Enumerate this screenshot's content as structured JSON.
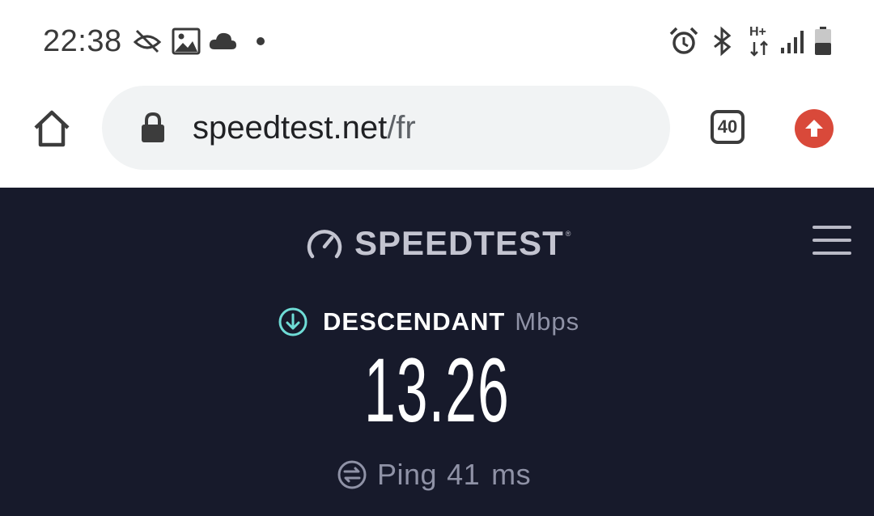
{
  "status_bar": {
    "time": "22:38",
    "icons_left": [
      "eye-off-icon",
      "image-icon",
      "cloud-icon",
      "dot-icon"
    ],
    "icons_right": [
      "alarm-icon",
      "bluetooth-icon",
      "hplus-data-icon",
      "signal-icon",
      "battery-icon"
    ],
    "network_label": "H+"
  },
  "browser": {
    "url_domain": "speedtest.net",
    "url_path": "/fr",
    "tab_count": "40"
  },
  "page": {
    "brand": "SPEEDTEST",
    "trademark": "®",
    "download_label": "DESCENDANT",
    "unit": "Mbps",
    "speed_value": "13.26",
    "ping_label": "Ping",
    "ping_value": "41",
    "ping_unit": "ms"
  },
  "colors": {
    "page_bg": "#171a2b",
    "accent_teal": "#6fdcd6",
    "update_red": "#d9493a",
    "muted_text": "#8f92a6"
  }
}
